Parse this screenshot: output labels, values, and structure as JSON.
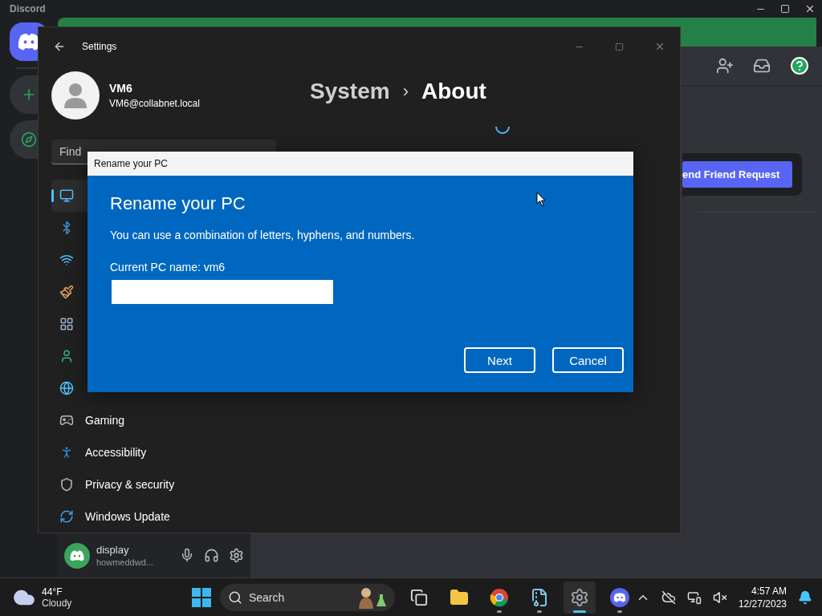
{
  "discord": {
    "title": "Discord",
    "friend_request_button": "end Friend Request",
    "user": {
      "name": "display",
      "tag": "howmeddwd..."
    }
  },
  "settings": {
    "title": "Settings",
    "account": {
      "name": "VM6",
      "email": "VM6@collabnet.local"
    },
    "search": {
      "placeholder": "Find"
    },
    "nav": [
      {
        "kind": "system",
        "selected": true
      },
      {
        "kind": "bluetooth",
        "selected": false
      },
      {
        "kind": "network",
        "selected": false
      },
      {
        "kind": "personalization",
        "selected": false
      },
      {
        "kind": "apps",
        "selected": false
      },
      {
        "kind": "accounts",
        "selected": false
      },
      {
        "kind": "time",
        "selected": false
      },
      {
        "kind": "gaming",
        "label": "Gaming",
        "selected": false
      },
      {
        "kind": "accessibility",
        "label": "Accessibility",
        "selected": false
      },
      {
        "kind": "privacy",
        "label": "Privacy & security",
        "selected": false
      },
      {
        "kind": "update",
        "label": "Windows Update",
        "selected": false
      }
    ],
    "breadcrumb": {
      "parent": "System",
      "separator": "›",
      "current": "About"
    }
  },
  "dialog": {
    "title": "Rename your PC",
    "heading": "Rename your PC",
    "description": "You can use a combination of letters, hyphens, and numbers.",
    "current_name": "Current PC name: vm6",
    "buttons": [
      "Next",
      "Cancel"
    ]
  },
  "taskbar": {
    "weather": {
      "temperature": "44°F",
      "condition": "Cloudy"
    },
    "search": {
      "placeholder": "Search"
    },
    "apps": [
      {
        "kind": "taskview",
        "running": false,
        "active": false
      },
      {
        "kind": "files",
        "running": false,
        "active": false
      },
      {
        "kind": "browser",
        "running": true,
        "active": false
      },
      {
        "kind": "archive",
        "running": true,
        "active": false
      },
      {
        "kind": "settings",
        "running": true,
        "active": true
      },
      {
        "kind": "chat",
        "running": true,
        "active": false
      }
    ],
    "clock": {
      "time": "4:57 AM",
      "date": "12/27/2023"
    }
  }
}
